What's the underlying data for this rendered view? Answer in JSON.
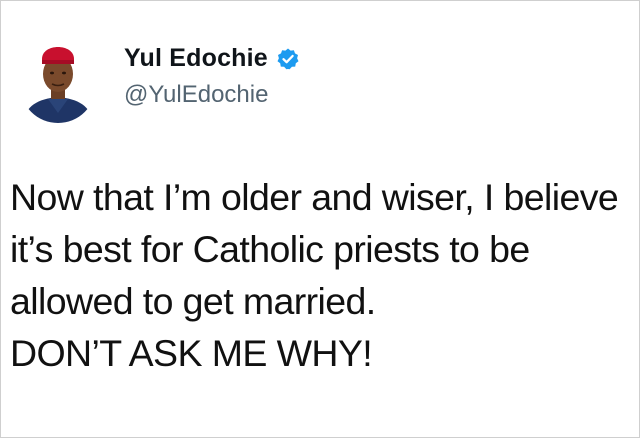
{
  "author": {
    "display_name": "Yul Edochie",
    "handle": "@YulEdochie",
    "verified_icon": "verified-badge-icon",
    "avatar_icon": "profile-photo",
    "verified_color": "#1d9bf0"
  },
  "tweet": {
    "lines": [
      "Now that I’m older and wiser, I believe",
      "it’s best for Catholic priests to be",
      "allowed to get married.",
      "DON’T ASK ME WHY!"
    ]
  }
}
